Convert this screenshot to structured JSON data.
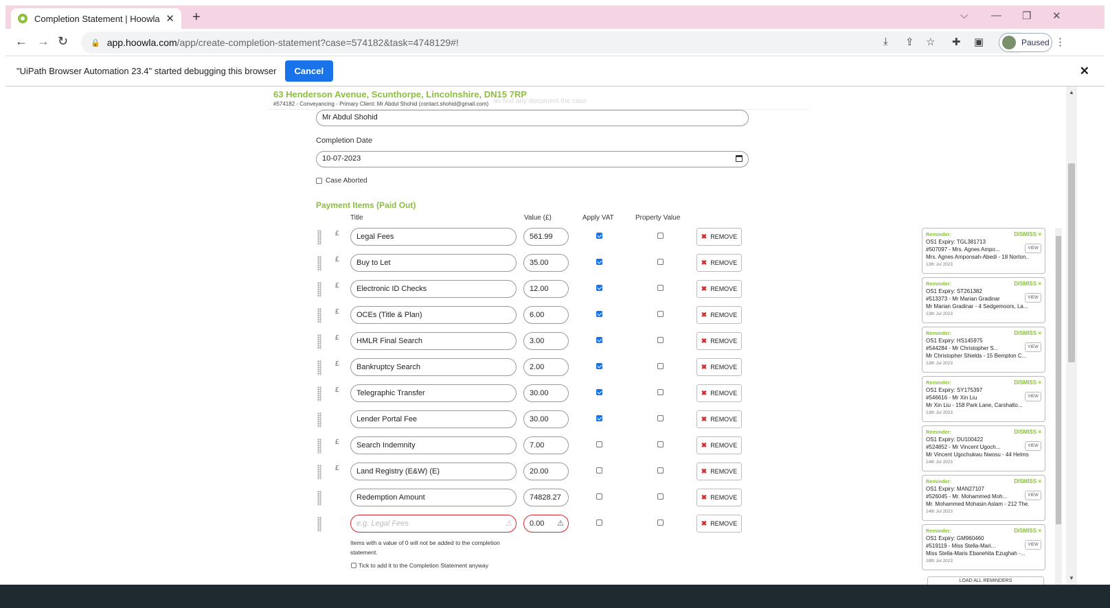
{
  "browser": {
    "tab_title": "Completion Statement | Hoowla",
    "tab_close": "✕",
    "new_tab": "+",
    "url_host": "app.hoowla.com",
    "url_path": "/app/create-completion-statement?case=574182&task=4748129#!",
    "profile_status": "Paused",
    "debug_message": "\"UiPath Browser Automation 23.4\" started debugging this browser",
    "debug_cancel": "Cancel",
    "debug_close": "✕"
  },
  "case_header": {
    "address": "63 Henderson Avenue, Scunthorpe, Lincolnshire, DN15 7RP",
    "details": "#574182 - Conveyancing - Primary Client: Mr Abdul Shohid (contact.shohid@gmail.com)",
    "ghost_text": "on find any document the case"
  },
  "form": {
    "client_name": "Mr Abdul Shohid",
    "completion_date_label": "Completion Date",
    "completion_date": "10-07-2023",
    "case_aborted_label": "Case Aborted",
    "case_aborted": false
  },
  "payment_items": {
    "section_title": "Payment Items (Paid Out)",
    "columns": {
      "title": "Title",
      "value": "Value (£)",
      "vat": "Apply VAT",
      "property": "Property Value"
    },
    "remove_label": "REMOVE",
    "rows": [
      {
        "pound": "£",
        "title": "Legal Fees",
        "value": "561.99",
        "vat": true,
        "property": false
      },
      {
        "pound": "£",
        "title": "Buy to Let",
        "value": "35.00",
        "vat": true,
        "property": false
      },
      {
        "pound": "£",
        "title": "Electronic ID Checks",
        "value": "12.00",
        "vat": true,
        "property": false
      },
      {
        "pound": "£",
        "title": "OCEs (Title & Plan)",
        "value": "6.00",
        "vat": true,
        "property": false
      },
      {
        "pound": "£",
        "title": "HMLR Final Search",
        "value": "3.00",
        "vat": true,
        "property": false
      },
      {
        "pound": "£",
        "title": "Bankruptcy Search",
        "value": "2.00",
        "vat": true,
        "property": false
      },
      {
        "pound": "£",
        "title": "Telegraphic Transfer",
        "value": "30.00",
        "vat": true,
        "property": false
      },
      {
        "pound": "",
        "title": "Lender Portal Fee",
        "value": "30.00",
        "vat": true,
        "property": false
      },
      {
        "pound": "£",
        "title": "Search Indemnity",
        "value": "7.00",
        "vat": false,
        "property": false
      },
      {
        "pound": "£",
        "title": "Land Registry (E&W) (E)",
        "value": "20.00",
        "vat": false,
        "property": false
      },
      {
        "pound": "",
        "title": "Redemption Amount",
        "value": "74828.27",
        "vat": false,
        "property": false
      }
    ],
    "new_row": {
      "title_placeholder": "e.g. Legal Fees",
      "value": "0.00",
      "vat": false,
      "property": false
    },
    "zero_note": "Items with a value of 0 will not be added to the completion statement.",
    "tick_label": "Tick to add it to the Completion Statement anyway"
  },
  "reminders": {
    "label": "Reminder:",
    "dismiss": "DISMISS ×",
    "view": "VIEW",
    "load_all": "LOAD ALL REMINDERS",
    "items": [
      {
        "title": "OS1 Expiry: TGL381713",
        "ref": "#507097 - Mrs. Agnes Ampo...",
        "desc": "Mrs. Agnes Amponsah-Abedi - 18 Norton...",
        "date": "13th Jul 2023"
      },
      {
        "title": "OS1 Expiry: ST261382",
        "ref": "#513373 - Mr Marian Gradinar",
        "desc": "Mr Marian Gradinar - 4 Sedgemoors, La...",
        "date": "13th Jul 2023"
      },
      {
        "title": "OS1 Expiry: HS145975",
        "ref": "#544284 - Mr Christopher S...",
        "desc": "Mr Christopher Shields - 15 Bempton C...",
        "date": "13th Jul 2023"
      },
      {
        "title": "OS1 Expiry: SY175397",
        "ref": "#546616 - Mr Xin Liu",
        "desc": "Mr Xin Liu - 158 Park Lane, Carshalto...",
        "date": "13th Jul 2023"
      },
      {
        "title": "OS1 Expiry: DU100422",
        "ref": "#524852 - Mr Vincent Ugoch...",
        "desc": "Mr Vincent Ugochukwu Nwosu - 44 Helms...",
        "date": "14th Jul 2023"
      },
      {
        "title": "OS1 Expiry: MAN27107",
        "ref": "#526045 - Mr. Mohammed Moh...",
        "desc": "Mr. Mohammed Mohasin Aslam - 212 The...",
        "date": "14th Jul 2023"
      },
      {
        "title": "OS1 Expiry: GM960460",
        "ref": "#519119 - Miss Stella-Mari...",
        "desc": "Miss Stella-Maris Ebanehita Ezughah -...",
        "date": "18th Jul 2023"
      }
    ]
  },
  "icons": [
    "favicon-icon",
    "back-arrow-icon",
    "forward-arrow-icon",
    "reload-icon",
    "lock-icon",
    "install-icon",
    "share-icon",
    "star-icon",
    "extensions-icon",
    "sidepanel-icon",
    "more-icon",
    "calendar-icon",
    "drag-handle-icon",
    "close-x-icon",
    "warning-icon"
  ]
}
